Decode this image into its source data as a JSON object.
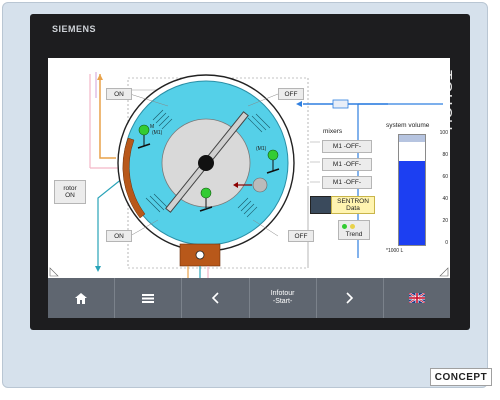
{
  "device": {
    "brand": "SIEMENS",
    "label": "TOUCH"
  },
  "hmi": {
    "valve_top_left": "ON",
    "valve_top_right": "OFF",
    "valve_bottom_left": "ON",
    "valve_bottom_right": "OFF",
    "rotor_label": "rotor\nON",
    "mixers_title": "mixers",
    "mixers": [
      "M1 -OFF-",
      "M1 -OFF-",
      "M1 -OFF-"
    ],
    "sentron_label": "SENTRON\nData",
    "trend_label": "Trend",
    "motor_symbol": "M",
    "motor_tags": [
      "(M1)",
      "(M1)"
    ],
    "system_volume": {
      "title": "system volume",
      "ticks": [
        "100",
        "80",
        "60",
        "40",
        "20",
        "0"
      ],
      "unit": "*1000 L",
      "max": 100,
      "value": 76
    }
  },
  "navbar": {
    "home_icon": "home-icon",
    "list_icon": "list-icon",
    "back_icon": "chevron-left-icon",
    "infotour": "Infotour\n-Start-",
    "forward_icon": "chevron-right-icon",
    "language_icon": "uk-flag-icon"
  },
  "corner_logo": "CONCEPT"
}
